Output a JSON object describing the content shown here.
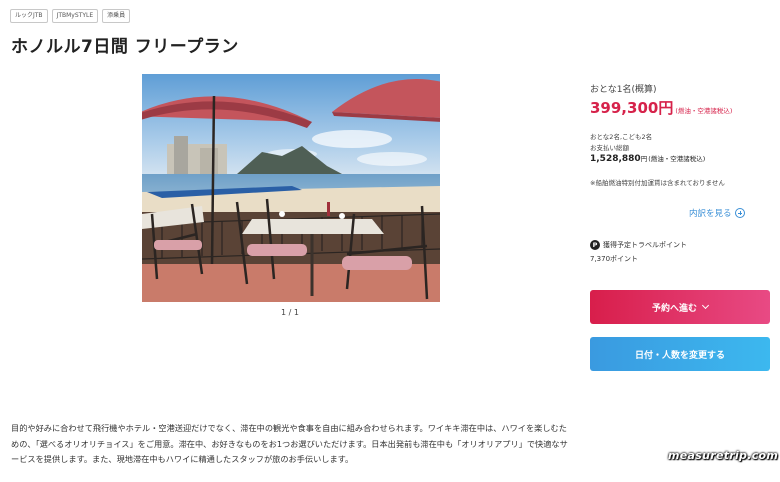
{
  "tags": [
    "ルックJTB",
    "JTBMySTYLE",
    "添乗員"
  ],
  "title": "ホノルル7日間 フリープラン",
  "gallery": {
    "pager": "1 / 1"
  },
  "price_panel": {
    "per_person_label": "おとな1名(概算)",
    "per_person_price": "399,300円",
    "per_person_note": "(燃油・空港諸税込)",
    "party_label": "おとな2名,こども2名",
    "payment_label": "お支払い総額",
    "total_price": "1,528,880",
    "total_unit": "円",
    "total_note": "(燃油・空港諸税込)",
    "surcharge_notice": "※船舶燃油特別付加運賃は含まれておりません",
    "breakdown_link": "内訳を見る",
    "points_icon": "P",
    "points_label": "獲得予定トラベルポイント",
    "points_value": "7,370ポイント",
    "reserve_button": "予約へ進む",
    "change_button": "日付・人数を変更する"
  },
  "description": "目的や好みに合わせて飛行機やホテル・空港送迎だけでなく、滞在中の観光や食事を自由に組み合わせられます。ワイキキ滞在中は、ハワイを楽しむための、「選べるオリオリチョイス」をご用意。滞在中、お好きなものをお1つお選びいただけます。日本出発前も滞在中も「オリオリアプリ」で快適なサービスを提供します。また、現地滞在中もハワイに精通したスタッフが旅のお手伝いします。",
  "watermark": "measuretrip.com",
  "colors": {
    "price_red": "#d6224a",
    "link_blue": "#3a8fd6",
    "reserve_start": "#d81e4b",
    "reserve_end": "#e84a84",
    "change_start": "#3a9ae0",
    "change_end": "#3cb8ef"
  },
  "icons": {
    "breakdown": "plus-circle-icon",
    "points": "points-p-icon",
    "reserve": "chevron-down-icon"
  }
}
